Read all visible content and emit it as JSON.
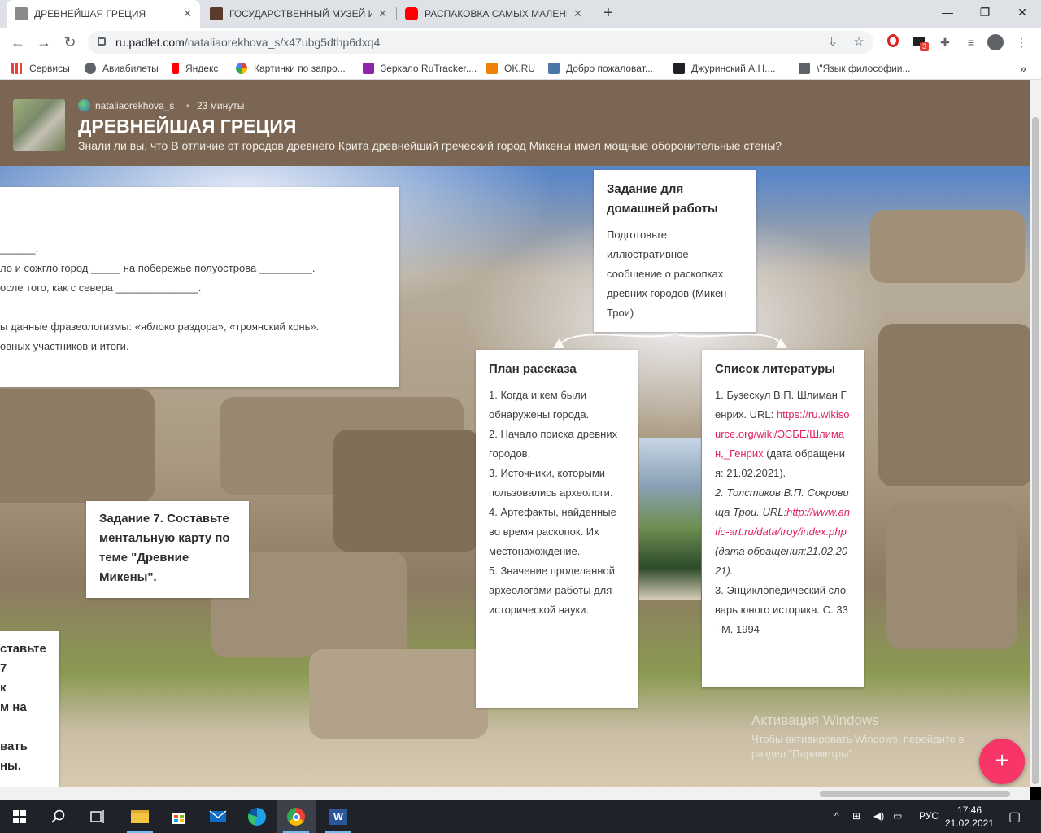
{
  "browser": {
    "tabs": [
      {
        "title": "ДРЕВНЕЙШАЯ ГРЕЦИЯ",
        "favicon_color": "#8a8a8a",
        "active": true
      },
      {
        "title": "ГОСУДАРСТВЕННЫЙ МУЗЕЙ ИЗ",
        "favicon_color": "#5a3a2a",
        "active": false
      },
      {
        "title": "РАСПАКОВКА САМЫХ МАЛЕНЬ",
        "favicon_color": "#ff0000",
        "active": false
      }
    ],
    "url_host": "ru.padlet.com",
    "url_path": "/nataliaorekhova_s/x47ubg5dthp6dxq4",
    "extension_badge": "3",
    "bookmarks": [
      {
        "label": "Сервисы",
        "color": "#ea4335"
      },
      {
        "label": "Авиабилеты",
        "color": "#5f6368"
      },
      {
        "label": "Яндекс",
        "color": "#ff0000"
      },
      {
        "label": "Картинки по запро...",
        "color": "#4285f4"
      },
      {
        "label": "Зеркало RuTracker....",
        "color": "#8e24aa"
      },
      {
        "label": "OK.RU",
        "color": "#ee8208"
      },
      {
        "label": "Добро пожаловат...",
        "color": "#4a76a8"
      },
      {
        "label": "Джуринский А.Н....",
        "color": "#202124"
      },
      {
        "label": "\\\"Язык философии...",
        "color": "#5f6368"
      }
    ]
  },
  "padlet": {
    "author": "nataliaorekhova_s",
    "separator": "•",
    "time": "23 минуты",
    "title": "ДРЕВНЕЙШАЯ ГРЕЦИЯ",
    "description": "Знали ли вы, что В отличие от городов древнего Крита древнейший греческий город Микены имел мощные оборонительные стены?",
    "card_left": {
      "lines": [
        "______.",
        "ло и сожгло город _____ на побережье полуострова _________.",
        "осле того, как с севера ______________.",
        "",
        "ы данные фразеологизмы: «яблоко раздора», «троянский конь».",
        "овных участников и итоги."
      ]
    },
    "card_homework": {
      "title": "Задание для домашней работы",
      "body": "Подготовьте иллюстративное сообщение о раскопках древних городов (Микен Трои)"
    },
    "card_plan": {
      "title": "План рассказа",
      "items": [
        "1. Когда и кем были обнаружены города.",
        "2. Начало поиска древних городов.",
        "3. Источники, которыми пользовались археологи.",
        "4. Артефакты, найденные во время раскопок. Их местонахождение.",
        "5. Значение проделанной археологами работы для исторической науки."
      ]
    },
    "card_literature": {
      "title": "Список литературы",
      "item1_text": "1. Бузескул В.П. Шлиман Генрих. URL:",
      "item1_link": "https://ru.wikisource.org/wiki/ЭСБЕ/Шлиман,_Генрих",
      "item1_tail": " (дата обращения: 21.02.2021).",
      "item2_text": "2. Толстиков В.П. Сокровища Трои. URL:",
      "item2_link": "http://www.antic-art.ru/data/troy/index.php",
      "item2_tail": " (дата обращения:21.02.2021).",
      "item3_text": "3. Энциклопедический словарь юного историка. С. 33 - М. 1994"
    },
    "card_task7": {
      "title": "Задание 7. Составьте ментальную карту по теме \"Древние Микены\"."
    },
    "card_bottom_left": {
      "lines": [
        "ставьте",
        "7",
        "к",
        "м на",
        "",
        "вать",
        "ны."
      ]
    },
    "fab_label": "+",
    "watermark_title": "Активация Windows",
    "watermark_sub": "Чтобы активировать Windows, перейдите в раздел \"Параметры\"."
  },
  "taskbar": {
    "tray_lang": "РУС",
    "time": "17:46",
    "date": "21.02.2021"
  }
}
